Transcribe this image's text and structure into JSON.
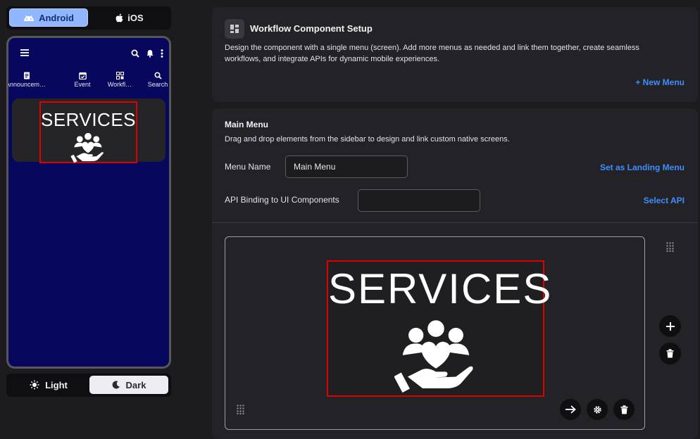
{
  "platform_toggle": {
    "android_label": "Android",
    "ios_label": "iOS",
    "selected": "Android"
  },
  "preview": {
    "tabs": [
      {
        "label": "Announceme…",
        "icon": "announcement-icon"
      },
      {
        "label": "Event",
        "icon": "calendar-icon"
      },
      {
        "label": "Workfl…",
        "icon": "workflow-icon"
      },
      {
        "label": "Search",
        "icon": "search-icon"
      }
    ],
    "card_text": "SERVICES",
    "colors": {
      "phone_background": "#07075e",
      "highlight": "#e00000"
    }
  },
  "theme_toggle": {
    "light_label": "Light",
    "dark_label": "Dark",
    "selected": "Dark"
  },
  "setup": {
    "title": "Workflow Component Setup",
    "description": "Design the component with a single menu (screen). Add more menus as needed and link them together, create seamless workflows, and integrate APIs for dynamic mobile experiences.",
    "new_menu_label": "+ New Menu"
  },
  "main_menu": {
    "title": "Main Menu",
    "description": "Drag and drop elements from the sidebar to design and link custom native screens.",
    "menu_name_label": "Menu Name",
    "menu_name_value": "Main Menu",
    "landing_label": "Set as Landing Menu",
    "api_label": "API Binding to UI Components",
    "api_value": "",
    "select_api_label": "Select API",
    "canvas_text": "SERVICES"
  },
  "accent_color": "#3f8dff"
}
